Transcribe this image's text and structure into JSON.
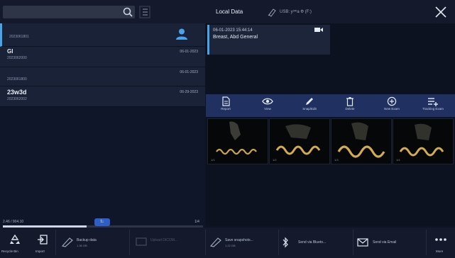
{
  "search": {
    "placeholder": ""
  },
  "tabs": {
    "local_data": "Local Data",
    "usb": "USB: yᵒᵐa Ф (F:)"
  },
  "patients": [
    {
      "name": "",
      "id": "2023061801",
      "date": ""
    },
    {
      "name": "GI",
      "id": "2023062000",
      "date": "06-01-2023"
    },
    {
      "name": "",
      "id": "2023061800",
      "date": "06-01-2023"
    },
    {
      "name": "23w3d",
      "id": "2023062002",
      "date": "06-29-2023"
    }
  ],
  "storage": {
    "used": "2.46 / 904.10",
    "fraction": 0.42,
    "badge": "t↓",
    "right": "1/4"
  },
  "exam": {
    "time": "06-01-2023 15:44:14",
    "name": "Breast, Abd General"
  },
  "toolbar": [
    {
      "label": "Report",
      "icon": "report-icon"
    },
    {
      "label": "View",
      "icon": "eye-icon"
    },
    {
      "label": "Snap/Edit",
      "icon": "pencil-icon"
    },
    {
      "label": "Delete",
      "icon": "trash-icon"
    },
    {
      "label": "New Exam",
      "icon": "plus-circle-icon"
    },
    {
      "label": "Tracking Exam",
      "icon": "playlist-add-icon"
    }
  ],
  "thumbnails": [
    "1/1",
    "1/2",
    "1/3",
    "1/4"
  ],
  "bottom": {
    "recycle": "Recycle Bin",
    "import": "Import",
    "backup": "Backup data",
    "backup_sub": "1.36 GB",
    "upload": "Upload DICOM...",
    "upload_sub": "",
    "save": "Save snapshots...",
    "save_sub": "1.22 GB",
    "bluetooth": "Send via Blueto...",
    "email": "Send via Email",
    "more": "More"
  },
  "colors": {
    "accent": "#4aa3e8",
    "toolbar": "#203060",
    "badge": "#2e5fc7"
  }
}
